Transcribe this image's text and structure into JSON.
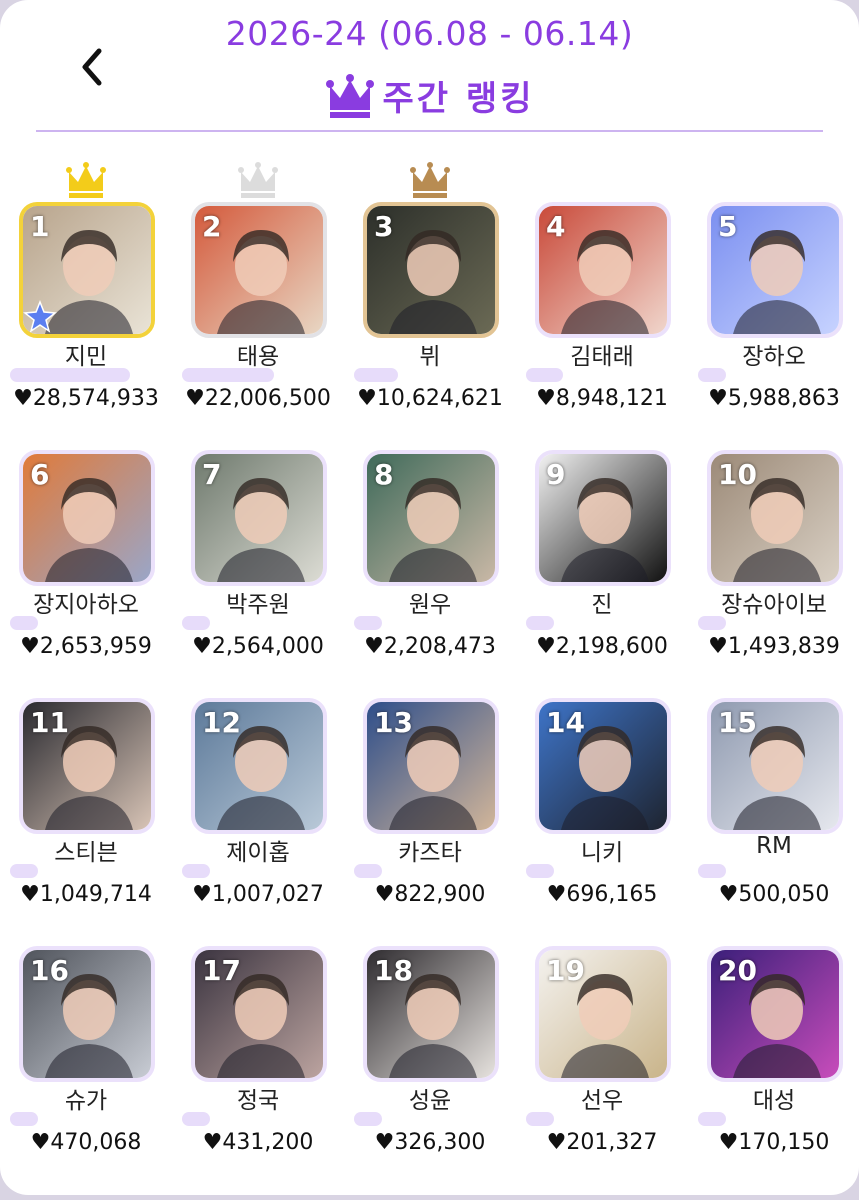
{
  "header": {
    "period": "2026-24 (06.08 - 06.14)",
    "title": "주간 랭킹",
    "back_icon": "chevron-left-icon",
    "title_icon": "crown-icon",
    "accent_color": "#8a3ce0"
  },
  "ranking": [
    {
      "rank": "1",
      "name": "지민",
      "votes": "28,574,933",
      "bar": 1.0,
      "crown": "gold",
      "bg": [
        "#b8a48c",
        "#e9e3d6"
      ],
      "star": true
    },
    {
      "rank": "2",
      "name": "태용",
      "votes": "22,006,500",
      "bar": 0.77,
      "crown": "silver",
      "bg": [
        "#d45a3c",
        "#e8d7c4"
      ]
    },
    {
      "rank": "3",
      "name": "뷔",
      "votes": "10,624,621",
      "bar": 0.37,
      "crown": "bronze",
      "bg": [
        "#2c2f2a",
        "#6b6a55"
      ]
    },
    {
      "rank": "4",
      "name": "김태래",
      "votes": "8,948,121",
      "bar": 0.31,
      "bg": [
        "#c94a3a",
        "#f0d6cc"
      ]
    },
    {
      "rank": "5",
      "name": "장하오",
      "votes": "5,988,863",
      "bar": 0.21,
      "bg": [
        "#7b8ff0",
        "#c7d3ff"
      ]
    },
    {
      "rank": "6",
      "name": "장지아하오",
      "votes": "2,653,959",
      "bar": 0.09,
      "bg": [
        "#e07a3a",
        "#9aa6c8"
      ]
    },
    {
      "rank": "7",
      "name": "박주원",
      "votes": "2,564,000",
      "bar": 0.09,
      "bg": [
        "#6f7a6e",
        "#dcdcd4"
      ]
    },
    {
      "rank": "8",
      "name": "원우",
      "votes": "2,208,473",
      "bar": 0.08,
      "bg": [
        "#3f6a5a",
        "#c9b8a6"
      ]
    },
    {
      "rank": "9",
      "name": "진",
      "votes": "2,198,600",
      "bar": 0.08,
      "bg": [
        "#f2f2f2",
        "#111111"
      ]
    },
    {
      "rank": "10",
      "name": "장슈아이보",
      "votes": "1,493,839",
      "bar": 0.05,
      "bg": [
        "#9c8a78",
        "#d9d0c4"
      ]
    },
    {
      "rank": "11",
      "name": "스티븐",
      "votes": "1,049,714",
      "bar": 0.04,
      "bg": [
        "#2a2a30",
        "#d8c4b6"
      ]
    },
    {
      "rank": "12",
      "name": "제이홉",
      "votes": "1,007,027",
      "bar": 0.04,
      "bg": [
        "#5d7a9a",
        "#b9c9d8"
      ]
    },
    {
      "rank": "13",
      "name": "카즈타",
      "votes": "822,900",
      "bar": 0.03,
      "bg": [
        "#2e4e8a",
        "#d2b69a"
      ]
    },
    {
      "rank": "14",
      "name": "니키",
      "votes": "696,165",
      "bar": 0.02,
      "bg": [
        "#3e74c8",
        "#1e2430"
      ]
    },
    {
      "rank": "15",
      "name": "RM",
      "votes": "500,050",
      "bar": 0.02,
      "bg": [
        "#8f9ab0",
        "#e6e8ee"
      ]
    },
    {
      "rank": "16",
      "name": "슈가",
      "votes": "470,068",
      "bar": 0.02,
      "bg": [
        "#50545c",
        "#c8ccd4"
      ]
    },
    {
      "rank": "17",
      "name": "정국",
      "votes": "431,200",
      "bar": 0.02,
      "bg": [
        "#3b3440",
        "#bca4a0"
      ]
    },
    {
      "rank": "18",
      "name": "성윤",
      "votes": "326,300",
      "bar": 0.01,
      "bg": [
        "#2f2c30",
        "#e6e2de"
      ]
    },
    {
      "rank": "19",
      "name": "선우",
      "votes": "201,327",
      "bar": 0.01,
      "bg": [
        "#f4f2ef",
        "#c9b48a"
      ]
    },
    {
      "rank": "20",
      "name": "대성",
      "votes": "170,150",
      "bar": 0.01,
      "bg": [
        "#3b1f7a",
        "#c84dbb"
      ]
    }
  ]
}
